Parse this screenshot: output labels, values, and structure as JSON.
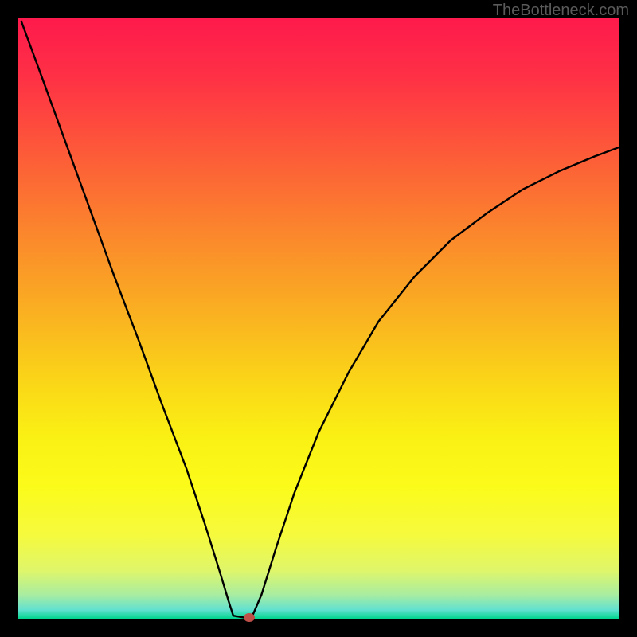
{
  "watermark": "TheBottleneck.com",
  "chart_data": {
    "type": "line",
    "title": "",
    "xlabel": "",
    "ylabel": "",
    "x_range": [
      0,
      100
    ],
    "y_range": [
      0,
      100
    ],
    "curve_points": [
      {
        "x": 0.5,
        "y": 99.5
      },
      {
        "x": 4,
        "y": 90
      },
      {
        "x": 8,
        "y": 79
      },
      {
        "x": 12,
        "y": 68
      },
      {
        "x": 16,
        "y": 57
      },
      {
        "x": 20,
        "y": 46.5
      },
      {
        "x": 24,
        "y": 35.5
      },
      {
        "x": 28,
        "y": 25
      },
      {
        "x": 31,
        "y": 16
      },
      {
        "x": 33.5,
        "y": 8
      },
      {
        "x": 35,
        "y": 3
      },
      {
        "x": 35.8,
        "y": 0.5
      },
      {
        "x": 37.5,
        "y": 0.2
      },
      {
        "x": 39,
        "y": 0.5
      },
      {
        "x": 40.5,
        "y": 4
      },
      {
        "x": 43,
        "y": 12
      },
      {
        "x": 46,
        "y": 21
      },
      {
        "x": 50,
        "y": 31
      },
      {
        "x": 55,
        "y": 41
      },
      {
        "x": 60,
        "y": 49.5
      },
      {
        "x": 66,
        "y": 57
      },
      {
        "x": 72,
        "y": 63
      },
      {
        "x": 78,
        "y": 67.5
      },
      {
        "x": 84,
        "y": 71.5
      },
      {
        "x": 90,
        "y": 74.5
      },
      {
        "x": 96,
        "y": 77
      },
      {
        "x": 100,
        "y": 78.5
      }
    ],
    "marker": {
      "x": 38.4,
      "y": 0.2,
      "color": "#be5048"
    },
    "gradient_stops": [
      {
        "offset": 0,
        "color": "#fe1a4c"
      },
      {
        "offset": 0.1,
        "color": "#fe3145"
      },
      {
        "offset": 0.22,
        "color": "#fd5939"
      },
      {
        "offset": 0.35,
        "color": "#fb842d"
      },
      {
        "offset": 0.48,
        "color": "#faad22"
      },
      {
        "offset": 0.6,
        "color": "#fad418"
      },
      {
        "offset": 0.7,
        "color": "#faf114"
      },
      {
        "offset": 0.78,
        "color": "#fbfb1a"
      },
      {
        "offset": 0.86,
        "color": "#f6fa3d"
      },
      {
        "offset": 0.92,
        "color": "#dff66b"
      },
      {
        "offset": 0.96,
        "color": "#a9eda0"
      },
      {
        "offset": 0.985,
        "color": "#62e1d0"
      },
      {
        "offset": 1.0,
        "color": "#00d68e"
      }
    ]
  }
}
